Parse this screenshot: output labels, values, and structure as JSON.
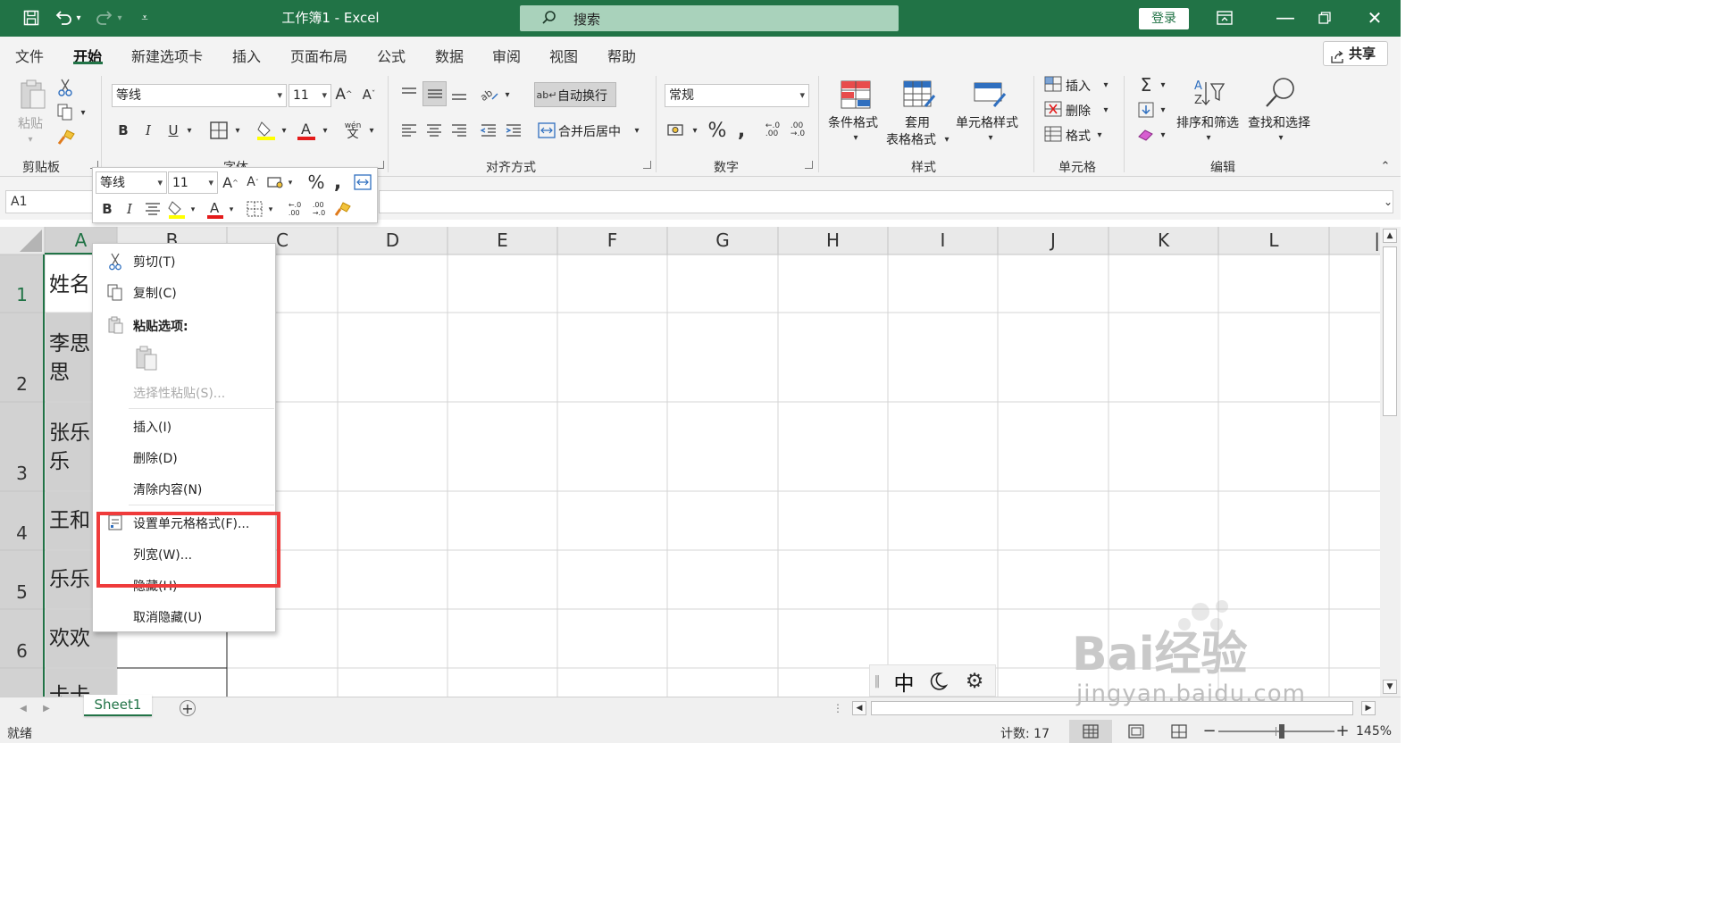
{
  "titlebar": {
    "title": "工作簿1  -  Excel",
    "search_placeholder": "搜索",
    "login": "登录"
  },
  "menu": {
    "tabs": [
      "文件",
      "开始",
      "新建选项卡",
      "插入",
      "页面布局",
      "公式",
      "数据",
      "审阅",
      "视图",
      "帮助"
    ],
    "active": "开始",
    "share": "共享"
  },
  "ribbon": {
    "clipboard": {
      "paste": "粘贴",
      "label": "剪贴板"
    },
    "font": {
      "name": "等线",
      "size": "11",
      "pinyin": "wén",
      "label": "字体"
    },
    "alignment": {
      "wrap": "自动换行",
      "merge": "合并后居中",
      "label": "对齐方式"
    },
    "number": {
      "format": "常规",
      "label": "数字"
    },
    "styles": {
      "conditional": "条件格式",
      "table_line1": "套用",
      "table_line2": "表格格式",
      "cell_styles": "单元格样式",
      "label": "样式"
    },
    "cells": {
      "insert": "插入",
      "delete": "删除",
      "format": "格式",
      "label": "单元格"
    },
    "editing": {
      "sort": "排序和筛选",
      "find": "查找和选择",
      "label": "编辑"
    }
  },
  "formula_bar": {
    "name_box": "A1",
    "formula": ""
  },
  "mini_toolbar": {
    "font": "等线",
    "size": "11"
  },
  "grid": {
    "columns": [
      "A",
      "B",
      "C",
      "D",
      "E",
      "F",
      "G",
      "H",
      "I",
      "J",
      "K",
      "L",
      "M"
    ],
    "rows": [
      "1",
      "2",
      "3",
      "4",
      "5",
      "6"
    ],
    "cells_visible": [
      "姓名",
      "李思",
      "思",
      "张乐",
      "乐",
      "王和",
      "乐乐",
      "欢欢",
      "卡卡"
    ]
  },
  "context_menu": {
    "cut": "剪切(T)",
    "copy": "复制(C)",
    "paste_options": "粘贴选项:",
    "paste_special": "选择性粘贴(S)...",
    "insert": "插入(I)",
    "delete": "删除(D)",
    "clear": "清除内容(N)",
    "format_cells": "设置单元格格式(F)...",
    "column_width": "列宽(W)...",
    "hide": "隐藏(H)",
    "unhide": "取消隐藏(U)"
  },
  "sheets": {
    "tabs": [
      "Sheet1"
    ]
  },
  "status": {
    "ready": "就绪",
    "count": "计数: 17",
    "zoom": "145%"
  },
  "ime": {
    "mode": "中"
  },
  "watermark": {
    "brand": "Bai经验",
    "url": "jingyan.baidu.com"
  },
  "colors": {
    "excel_green": "#217346",
    "highlight_red": "#ef3b3b"
  }
}
